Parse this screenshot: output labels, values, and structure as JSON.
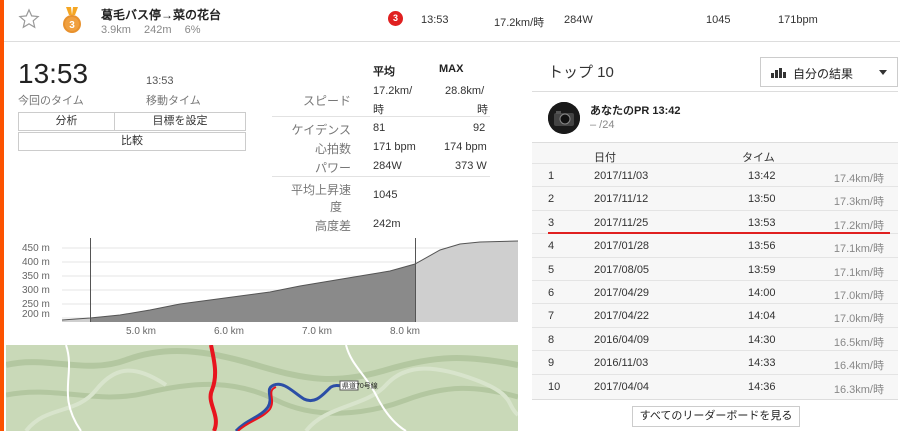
{
  "segment": {
    "name": "葛毛バス停→菜の花台",
    "distance": "3.9km",
    "elevation": "242m",
    "grade": "6%",
    "rank": "3",
    "medal_rank": "3",
    "time": "13:53",
    "speed": "17.2km/時",
    "power": "284W",
    "vam": "1045",
    "heartrate": "171bpm"
  },
  "effort": {
    "time": "13:53",
    "time_label": "今回のタイム",
    "moving_time": "13:53",
    "moving_time_label": "移動タイム",
    "buttons": {
      "analysis": "分析",
      "goal": "目標を設定",
      "compare": "比較"
    }
  },
  "stats": {
    "head_avg": "平均",
    "head_max": "MAX",
    "rows": [
      {
        "label": "スピード",
        "avg_1": "17.2km/",
        "avg_2": "時",
        "max_1": "28.8km/",
        "max_2": "時"
      },
      {
        "label": "ケイデンス",
        "avg": "81",
        "max": "92"
      },
      {
        "label": "心拍数",
        "avg": "171 bpm",
        "max": "174 bpm"
      },
      {
        "label": "パワー",
        "avg": "284W",
        "max": "373 W"
      },
      {
        "label_1": "平均上昇速",
        "label_2": "度",
        "avg": "1045"
      },
      {
        "label": "高度差",
        "avg": "242m"
      }
    ]
  },
  "elevation_chart": {
    "y_ticks": [
      "450 m",
      "400 m",
      "350 m",
      "300 m",
      "250 m",
      "200 m"
    ],
    "x_ticks": [
      "5.0 km",
      "6.0 km",
      "7.0 km",
      "8.0 km"
    ]
  },
  "map": {
    "label": "県道70号線"
  },
  "leaderboard": {
    "title": "トップ 10",
    "filter": "自分の結果",
    "pr_title": "あなたのPR 13:42",
    "pr_sub": "– /24",
    "col_date": "日付",
    "col_time": "タイム",
    "rows": [
      {
        "rank": "1",
        "date": "2017/11/03",
        "time": "13:42",
        "speed": "17.4km/時"
      },
      {
        "rank": "2",
        "date": "2017/11/12",
        "time": "13:50",
        "speed": "17.3km/時"
      },
      {
        "rank": "3",
        "date": "2017/11/25",
        "time": "13:53",
        "speed": "17.2km/時"
      },
      {
        "rank": "4",
        "date": "2017/01/28",
        "time": "13:56",
        "speed": "17.1km/時"
      },
      {
        "rank": "5",
        "date": "2017/08/05",
        "time": "13:59",
        "speed": "17.1km/時"
      },
      {
        "rank": "6",
        "date": "2017/04/29",
        "time": "14:00",
        "speed": "17.0km/時"
      },
      {
        "rank": "7",
        "date": "2017/04/22",
        "time": "14:04",
        "speed": "17.0km/時"
      },
      {
        "rank": "8",
        "date": "2016/04/09",
        "time": "14:30",
        "speed": "16.5km/時"
      },
      {
        "rank": "9",
        "date": "2016/11/03",
        "time": "14:33",
        "speed": "16.4km/時"
      },
      {
        "rank": "10",
        "date": "2017/04/04",
        "time": "14:36",
        "speed": "16.3km/時"
      }
    ],
    "view_all": "すべてのリーダーボードを見る"
  },
  "colors": {
    "accent": "#fc5200",
    "rank": "#e02020",
    "route_red": "#e8141e",
    "route_blue": "#2b4ea6"
  },
  "icons": {
    "star": "star-icon",
    "medal": "medal-icon",
    "chart": "bar-chart-icon",
    "caret": "chevron-down-icon"
  }
}
